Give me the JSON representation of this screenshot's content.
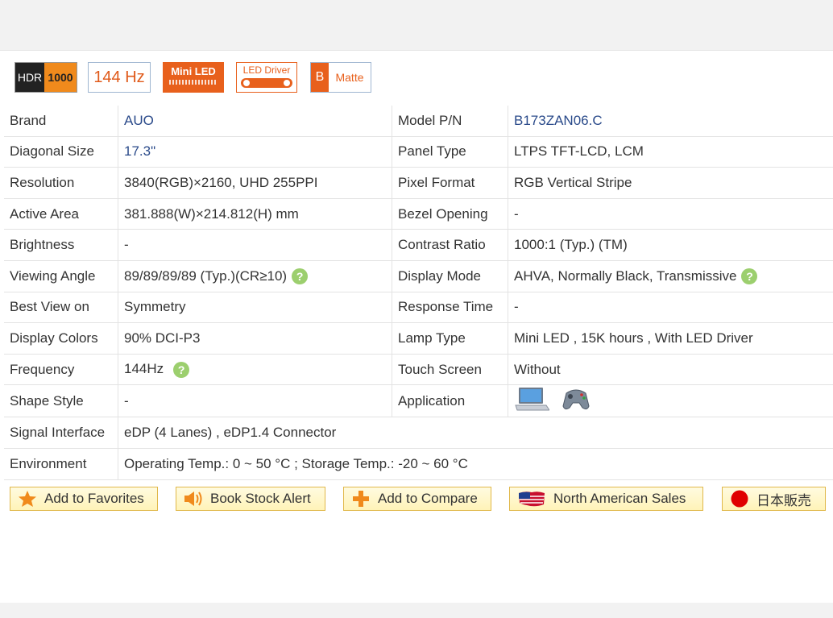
{
  "badges": {
    "hdr_left": "HDR",
    "hdr_right": "1000",
    "refresh": "144 Hz",
    "mini_led": "Mini LED",
    "led_driver": "LED Driver",
    "matte_left": "B",
    "matte_right": "Matte"
  },
  "specs": {
    "brand_label": "Brand",
    "brand_value": "AUO",
    "model_label": "Model P/N",
    "model_value": "B173ZAN06.C",
    "diag_label": "Diagonal Size",
    "diag_value": "17.3\"",
    "panel_label": "Panel Type",
    "panel_value": "LTPS TFT-LCD, LCM",
    "res_label": "Resolution",
    "res_value": "3840(RGB)×2160, UHD  255PPI",
    "pixfmt_label": "Pixel Format",
    "pixfmt_value": "RGB Vertical Stripe",
    "area_label": "Active Area",
    "area_value": "381.888(W)×214.812(H) mm",
    "bezel_label": "Bezel Opening",
    "bezel_value": "-",
    "bright_label": "Brightness",
    "bright_value": "-",
    "contrast_label": "Contrast Ratio",
    "contrast_value": "1000:1 (Typ.) (TM)",
    "angle_label": "Viewing Angle",
    "angle_value": "89/89/89/89 (Typ.)(CR≥10)",
    "mode_label": "Display Mode",
    "mode_value": "AHVA, Normally Black, Transmissive",
    "bestview_label": "Best View on",
    "bestview_value": "Symmetry",
    "resp_label": "Response Time",
    "resp_value": "-",
    "colors_label": "Display Colors",
    "colors_value": "90% DCI-P3",
    "lamp_label": "Lamp Type",
    "lamp_value": "Mini LED , 15K hours , With LED Driver",
    "freq_label": "Frequency",
    "freq_value": "144Hz",
    "touch_label": "Touch Screen",
    "touch_value": "Without",
    "shape_label": "Shape Style",
    "shape_value": "-",
    "app_label": "Application",
    "signal_label": "Signal Interface",
    "signal_value": "eDP (4 Lanes) , eDP1.4 Connector",
    "env_label": "Environment",
    "env_value": "Operating Temp.: 0 ~ 50 °C ; Storage Temp.: -20 ~ 60 °C",
    "help_glyph": "?"
  },
  "actions": {
    "favorites": "Add to Favorites",
    "stock_alert": "Book Stock Alert",
    "compare": "Add to Compare",
    "na_sales": "North American Sales",
    "jp_sales": "日本販売"
  },
  "icons": {
    "favorites": "star-icon",
    "stock_alert": "speaker-icon",
    "compare": "plus-icon",
    "na_sales": "us-flag-icon",
    "jp_sales": "japan-flag-icon",
    "app1": "laptop-icon",
    "app2": "gamepad-icon"
  },
  "colors": {
    "accent_orange": "#e8601c",
    "link_blue": "#2a4a8a",
    "help_green": "#9ccf6e",
    "button_border": "#e0b84a"
  }
}
